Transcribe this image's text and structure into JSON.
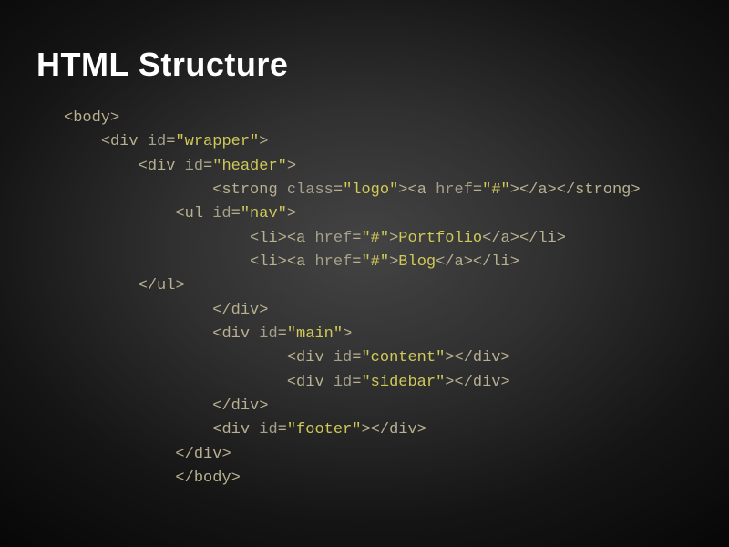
{
  "title": "HTML Structure",
  "code": {
    "l1": {
      "tag_open": "<",
      "tag": "body",
      "tag_close": ">"
    },
    "l2": {
      "tag_open": "<",
      "tag": "div",
      "sp": " ",
      "attr": "id",
      "eq": "=",
      "val": "\"wrapper\"",
      "tag_close": ">"
    },
    "l3": {
      "tag_open": "<",
      "tag": "div",
      "sp": " ",
      "attr": "id",
      "eq": "=",
      "val": "\"header\"",
      "tag_close": ">"
    },
    "l4": {
      "s_open": "<",
      "s_tag": "strong",
      "s_sp": " ",
      "s_attr": "class",
      "s_eq": "=",
      "s_val": "\"logo\"",
      "s_close": ">",
      "a_open": "<",
      "a_tag": "a",
      "a_sp": " ",
      "a_attr": "href",
      "a_eq": "=",
      "a_val": "\"#\"",
      "a_close": ">",
      "ae_open": "</",
      "ae_tag": "a",
      "ae_close": ">",
      "se_open": "</",
      "se_tag": "strong",
      "se_close": ">"
    },
    "l5": {
      "tag_open": "<",
      "tag": "ul",
      "sp": " ",
      "attr": "id",
      "eq": "=",
      "val": "\"nav\"",
      "tag_close": ">"
    },
    "l6": {
      "li_open": "<",
      "li_tag": "li",
      "li_close": ">",
      "a_open": "<",
      "a_tag": "a",
      "a_sp": " ",
      "a_attr": "href",
      "a_eq": "=",
      "a_val": "\"#\"",
      "a_close": ">",
      "txt": "Portfolio",
      "ae_open": "</",
      "ae_tag": "a",
      "ae_close": ">",
      "lie_open": "</",
      "lie_tag": "li",
      "lie_close": ">"
    },
    "l7": {
      "li_open": "<",
      "li_tag": "li",
      "li_close": ">",
      "a_open": "<",
      "a_tag": "a",
      "a_sp": " ",
      "a_attr": "href",
      "a_eq": "=",
      "a_val": "\"#\"",
      "a_close": ">",
      "txt": "Blog",
      "ae_open": "</",
      "ae_tag": "a",
      "ae_close": ">",
      "lie_open": "</",
      "lie_tag": "li",
      "lie_close": ">"
    },
    "l8": {
      "tag_open": "</",
      "tag": "ul",
      "tag_close": ">"
    },
    "l9": {
      "tag_open": "</",
      "tag": "div",
      "tag_close": ">"
    },
    "l10": {
      "tag_open": "<",
      "tag": "div",
      "sp": " ",
      "attr": "id",
      "eq": "=",
      "val": "\"main\"",
      "tag_close": ">"
    },
    "l11": {
      "o_open": "<",
      "o_tag": "div",
      "o_sp": " ",
      "o_attr": "id",
      "o_eq": "=",
      "o_val": "\"content\"",
      "o_close": ">",
      "e_open": "</",
      "e_tag": "div",
      "e_close": ">"
    },
    "l12": {
      "o_open": "<",
      "o_tag": "div",
      "o_sp": " ",
      "o_attr": "id",
      "o_eq": "=",
      "o_val": "\"sidebar\"",
      "o_close": ">",
      "e_open": "</",
      "e_tag": "div",
      "e_close": ">"
    },
    "l13": {
      "tag_open": "</",
      "tag": "div",
      "tag_close": ">"
    },
    "l14": {
      "o_open": "<",
      "o_tag": "div",
      "o_sp": " ",
      "o_attr": "id",
      "o_eq": "=",
      "o_val": "\"footer\"",
      "o_close": ">",
      "e_open": "</",
      "e_tag": "div",
      "e_close": ">"
    },
    "l15": {
      "tag_open": "</",
      "tag": "div",
      "tag_close": ">"
    },
    "l16": {
      "tag_open": "</",
      "tag": "body",
      "tag_close": ">"
    }
  }
}
